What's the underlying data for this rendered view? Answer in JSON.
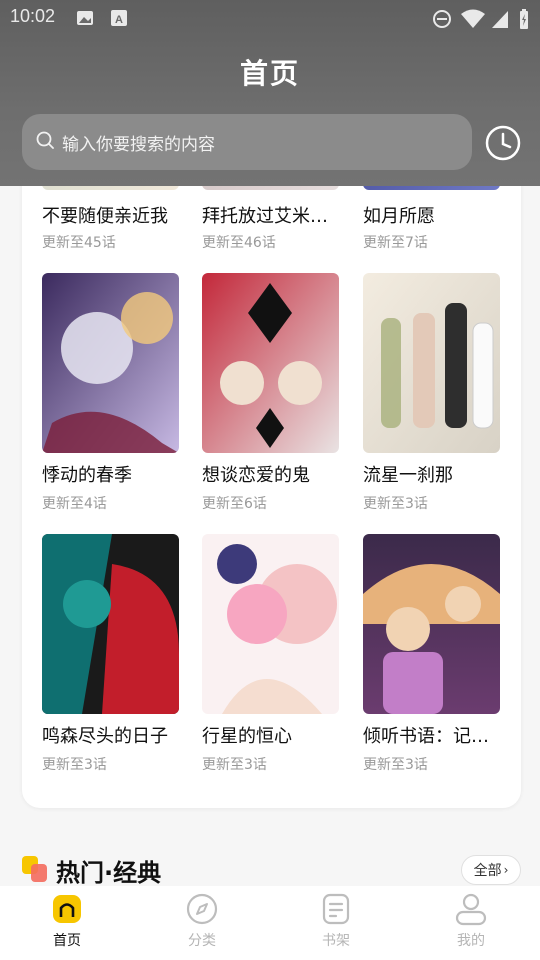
{
  "status_bar": {
    "time": "10:02"
  },
  "header": {
    "title": "首页",
    "search_placeholder": "输入你要搜索的内容"
  },
  "items": [
    {
      "title": "不要随便亲近我",
      "sub": "更新至45话",
      "colors": [
        "#cfd7c8",
        "#f1e9db"
      ]
    },
    {
      "title": "拜托放过艾米…",
      "sub": "更新至46话",
      "colors": [
        "#c9b8b8",
        "#e7dede"
      ]
    },
    {
      "title": "如月所愿",
      "sub": "更新至7话",
      "colors": [
        "#3a3f8c",
        "#6f79c6"
      ]
    },
    {
      "title": "悸动的春季",
      "sub": "更新至4话",
      "colors": [
        "#3b2a5e",
        "#c7b9e3"
      ]
    },
    {
      "title": "想谈恋爱的鬼",
      "sub": "更新至6话",
      "colors": [
        "#c3283a",
        "#e9e3e3"
      ]
    },
    {
      "title": "流星一刹那",
      "sub": "更新至3话",
      "colors": [
        "#f3ece0",
        "#d8d2c6"
      ]
    },
    {
      "title": "鸣森尽头的日子",
      "sub": "更新至3话",
      "colors": [
        "#0f6f70",
        "#c21e2b"
      ]
    },
    {
      "title": "行星的恒心",
      "sub": "更新至3话",
      "colors": [
        "#f2d7d9",
        "#f7b6c6"
      ]
    },
    {
      "title": "倾听书语：记…",
      "sub": "更新至3话",
      "colors": [
        "#6b3c6f",
        "#e7b27b"
      ]
    }
  ],
  "section": {
    "title": "热门·经典",
    "more_label": "全部"
  },
  "nav": [
    {
      "label": "首页",
      "icon": "home-icon",
      "active": true
    },
    {
      "label": "分类",
      "icon": "compass-icon",
      "active": false
    },
    {
      "label": "书架",
      "icon": "bookshelf-icon",
      "active": false
    },
    {
      "label": "我的",
      "icon": "profile-icon",
      "active": false
    }
  ],
  "colors": {
    "accent": "#f7c600",
    "header_bg": "#6a6a6a"
  }
}
